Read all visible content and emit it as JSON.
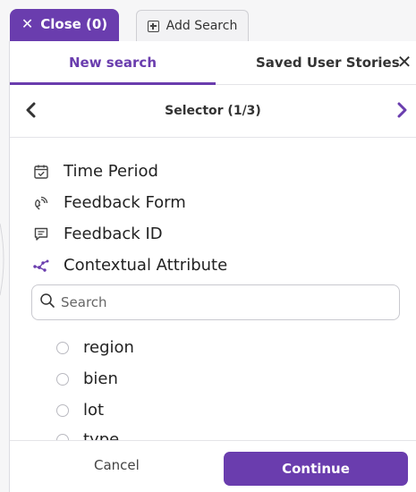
{
  "tabs": {
    "close_label": "Close (0)",
    "close_glyph": "✕",
    "add_search_label": "Add Search"
  },
  "panel": {
    "tab_new_search": "New search",
    "tab_saved_stories": "Saved User Stories",
    "close_glyph": "✕"
  },
  "selector": {
    "title": "Selector (1/3)"
  },
  "options": [
    {
      "label": "Time Period",
      "icon": "calendar-check-icon"
    },
    {
      "label": "Feedback Form",
      "icon": "feedback-form-icon"
    },
    {
      "label": "Feedback ID",
      "icon": "message-lines-icon"
    },
    {
      "label": "Contextual Attribute",
      "icon": "network-nodes-icon"
    }
  ],
  "search": {
    "placeholder": "Search",
    "value": ""
  },
  "attributes": [
    {
      "label": "region",
      "selected": false
    },
    {
      "label": "bien",
      "selected": false
    },
    {
      "label": "lot",
      "selected": false
    },
    {
      "label": "type",
      "selected": false
    }
  ],
  "footer": {
    "cancel_label": "Cancel",
    "continue_label": "Continue"
  },
  "colors": {
    "accent": "#6a3dae",
    "network_icon": "#6a3dae"
  }
}
